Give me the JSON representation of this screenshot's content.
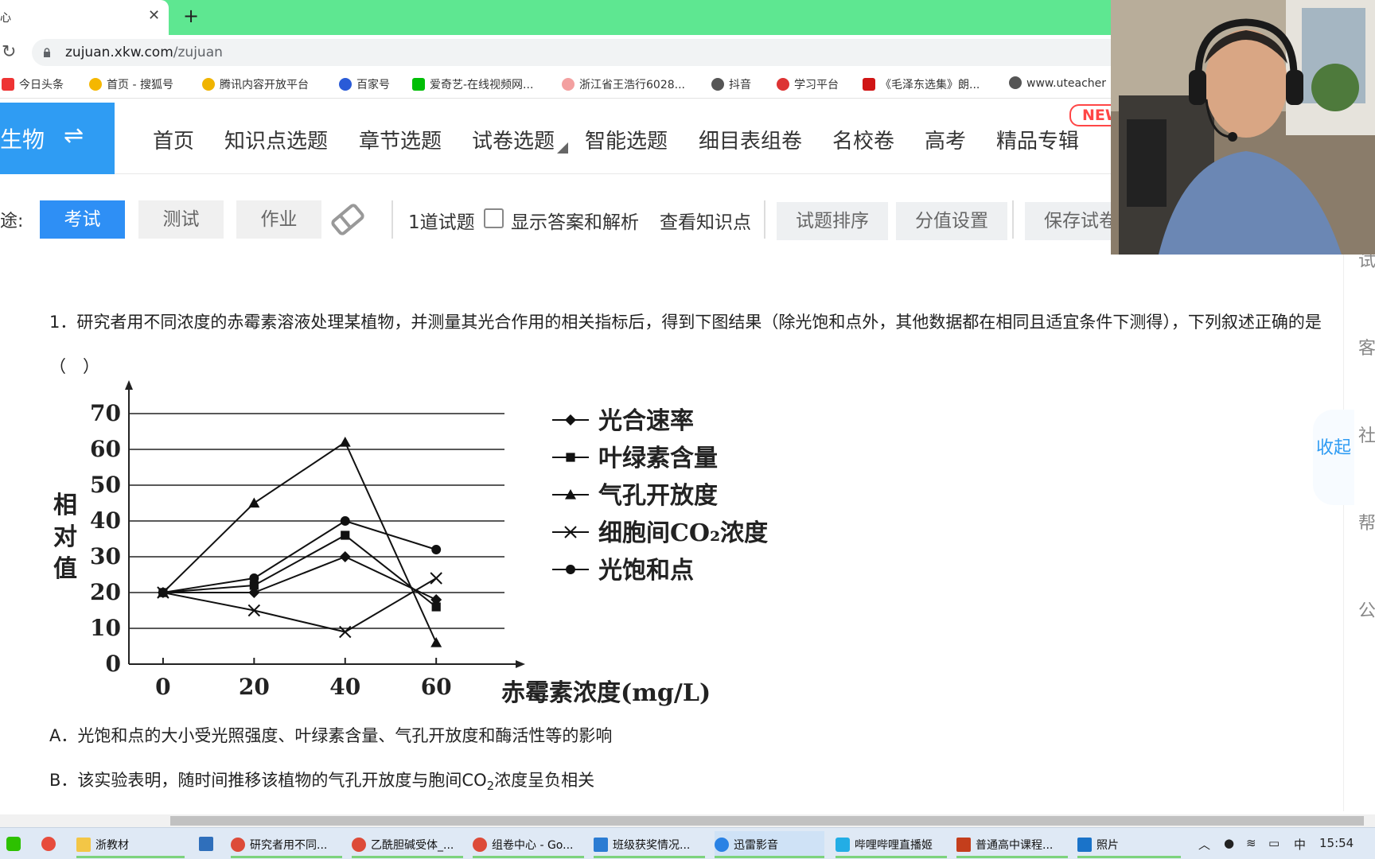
{
  "browser": {
    "tab_title": "心",
    "url_host": "zujuan.xkw.com",
    "url_path": "/zujuan",
    "bookmarks": [
      "今日头条",
      "首页 - 搜狐号",
      "腾讯内容开放平台",
      "百家号",
      "爱奇艺-在线视频网...",
      "浙江省王浩行6028...",
      "抖音",
      "学习平台",
      "《毛泽东选集》朗...",
      "www.uteacher"
    ]
  },
  "site": {
    "subject": "生物",
    "nav": [
      "首页",
      "知识点选题",
      "章节选题",
      "试卷选题",
      "智能选题",
      "细目表组卷",
      "名校卷",
      "高考",
      "精品专辑"
    ],
    "new_badge": "NEW"
  },
  "toolbar": {
    "label": "途:",
    "modes": [
      "考试",
      "测试",
      "作业"
    ],
    "count": "1道试题",
    "show_answer": "显示答案和解析",
    "view_points": "查看知识点",
    "sort": "试题排序",
    "score": "分值设置",
    "save": "保存试卷"
  },
  "question": {
    "text": "1．研究者用不同浓度的赤霉素溶液处理某植物，并测量其光合作用的相关指标后，得到下图结果（除光饱和点外，其他数据都在相同且适宜条件下测得），下列叙述正确的是（　）",
    "option_a": "A．光饱和点的大小受光照强度、叶绿素含量、气孔开放度和酶活性等的影响",
    "option_b_pre": "B．该实验表明，随时间推移该植物的气孔开放度与胞间CO",
    "option_b_sub": "2",
    "option_b_post": "浓度呈负相关"
  },
  "chart_data": {
    "type": "line",
    "x": [
      0,
      20,
      40,
      60
    ],
    "xlabel": "赤霉素浓度(mg/L)",
    "ylabel": "相对值",
    "ylim": [
      0,
      70
    ],
    "yticks": [
      0,
      10,
      20,
      30,
      40,
      50,
      60,
      70
    ],
    "grid": true,
    "legend_position": "right",
    "series": [
      {
        "name": "光合速率",
        "marker": "diamond",
        "values": [
          20,
          20,
          30,
          18
        ]
      },
      {
        "name": "叶绿素含量",
        "marker": "square",
        "values": [
          20,
          22,
          36,
          16
        ]
      },
      {
        "name": "气孔开放度",
        "marker": "triangle",
        "values": [
          20,
          45,
          62,
          6
        ]
      },
      {
        "name": "细胞间CO₂浓度",
        "marker": "x",
        "values": [
          20,
          15,
          9,
          24
        ]
      },
      {
        "name": "光饱和点",
        "marker": "circle",
        "values": [
          20,
          24,
          40,
          32
        ]
      }
    ]
  },
  "right_panel": {
    "chars": [
      "试",
      "客",
      "社",
      "帮",
      "公"
    ],
    "collapse": "收起"
  },
  "taskbar": {
    "items": [
      "浙教材",
      "研究者用不同...",
      "乙酰胆碱受体_...",
      "组卷中心 - Go...",
      "班级获奖情况...",
      "迅雷影音",
      "哔哩哔哩直播姬",
      "普通高中课程...",
      "照片"
    ],
    "ime": "中",
    "time": "15:54"
  }
}
